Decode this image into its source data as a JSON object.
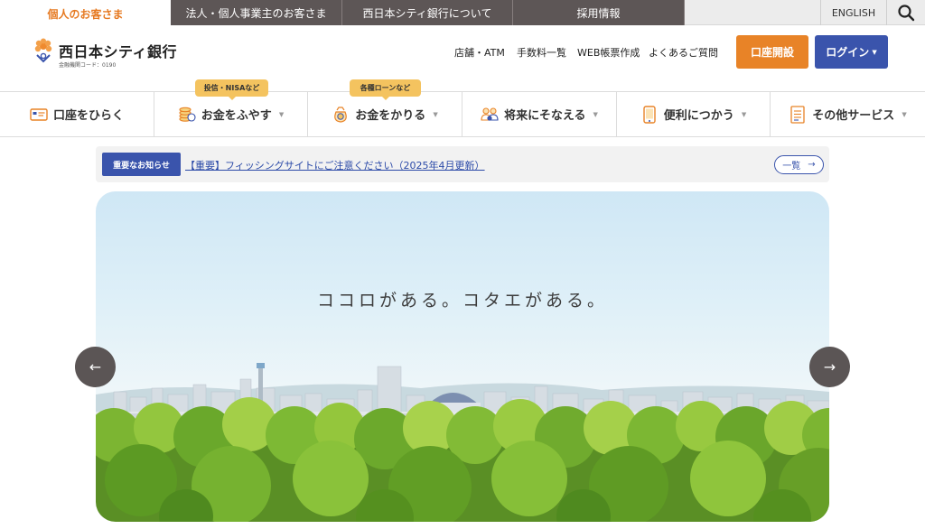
{
  "top_tabs": [
    {
      "label": "個人のお客さま",
      "active": true
    },
    {
      "label": "法人・個人事業主のお客さま"
    },
    {
      "label": "西日本シティ銀行について"
    },
    {
      "label": "採用情報"
    }
  ],
  "english_label": "ENGLISH",
  "search_icon": "search-icon",
  "logo": {
    "name": "西日本シティ銀行",
    "code": "金融機関コード：0190"
  },
  "util_links": [
    "店舗・ATM",
    "手数料一覧",
    "WEB帳票作成",
    "よくあるご質問"
  ],
  "buttons": {
    "open_account": "口座開設",
    "login": "ログイン"
  },
  "nav": [
    {
      "label": "口座をひらく",
      "icon": "card-icon",
      "tag": ""
    },
    {
      "label": "お金をふやす",
      "icon": "coins-icon",
      "tag": "投信・NISAなど"
    },
    {
      "label": "お金をかりる",
      "icon": "money-bag-icon",
      "tag": "各種ローンなど"
    },
    {
      "label": "将来にそなえる",
      "icon": "family-icon",
      "tag": ""
    },
    {
      "label": "便利につかう",
      "icon": "smartphone-icon",
      "tag": ""
    },
    {
      "label": "その他サービス",
      "icon": "document-icon",
      "tag": ""
    }
  ],
  "notice": {
    "badge": "重要なお知らせ",
    "link": "【重要】フィッシングサイトにご注意ください（2025年4月更新）",
    "all_label": "一覧"
  },
  "hero": {
    "slogan": "ココロがある。コタエがある。"
  },
  "colors": {
    "accent_orange": "#e88327",
    "brand_blue": "#3a54ac",
    "tab_dark": "#5d5656",
    "tag_yellow": "#f4c35f"
  }
}
